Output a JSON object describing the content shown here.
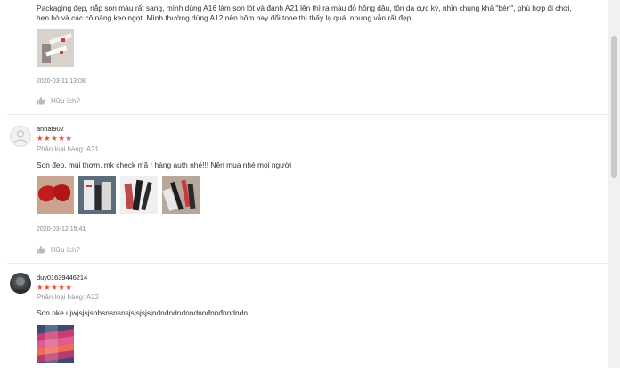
{
  "reviews": [
    {
      "text": "Packaging đẹp, nắp son màu rất sang, mình dùng A16 làm son lót và đánh A21 lên thì ra màu đỏ hồng dâu, tôn da cực kỳ, nhìn chung khá \"bén\", phù hợp đi chơi, hẹn hò và các cô nàng kẹo ngọt. Mình thường dùng A12 nên hôm nay đổi tone thì thấy lạ quá, nhưng vẫn rất đẹp",
      "date": "2020-03-11 13:08",
      "helpful_label": "Hữu ích?"
    },
    {
      "username": "anhat902",
      "stars": "★★★★★",
      "variant": "Phân loại hàng: A21",
      "text": "Son đẹp, mùi thơm, mk check mã r hàng auth nhé!!! Nên mua nhé mọi người",
      "date": "2020-03-12 15:41",
      "helpful_label": "Hữu ích?"
    },
    {
      "username": "duy01639446214",
      "stars": "★★★★★",
      "variant": "Phân loại hàng: A22",
      "text": "Son oke ujwjsjsjsnbsnsnsnsjsjsjsjsjndndndndnndnnđnnđnndndn"
    }
  ],
  "colors": {
    "star": "#ee4d2d",
    "muted": "#999999",
    "divider": "#ebebeb"
  },
  "icons": {
    "helpful": "thumbs-up-icon",
    "default_avatar": "user-icon"
  }
}
